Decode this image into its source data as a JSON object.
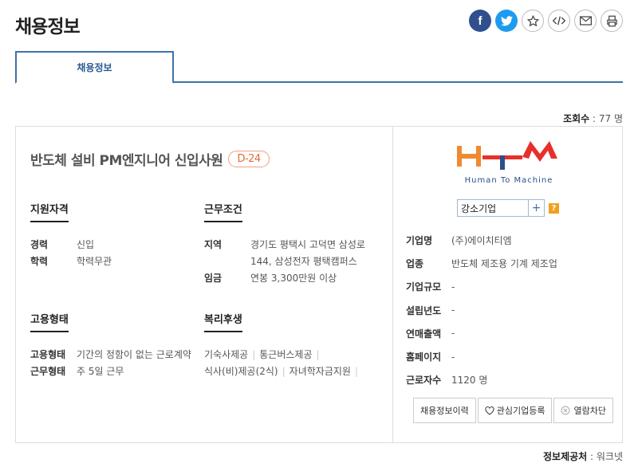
{
  "page_title": "채용정보",
  "share": {
    "facebook": "f"
  },
  "tab": {
    "label": "채용정보"
  },
  "views": {
    "label": "조회수",
    "value": "77 명"
  },
  "job": {
    "title": "반도체 설비 PM엔지니어 신입사원",
    "dday": "D-24"
  },
  "qualification": {
    "heading": "지원자격",
    "rows": [
      {
        "k": "경력",
        "v": "신입"
      },
      {
        "k": "학력",
        "v": "학력무관"
      }
    ]
  },
  "conditions": {
    "heading": "근무조건",
    "rows": [
      {
        "k": "지역",
        "v1": "경기도 평택시 고덕면 삼성로",
        "v2": "144, 삼성전자 평택캠퍼스"
      },
      {
        "k": "임금",
        "v1": "연봉 3,300만원 이상"
      }
    ]
  },
  "employment": {
    "heading": "고용형태",
    "rows": [
      {
        "k": "고용형태",
        "v": "기간의 정함이 없는 근로계약"
      },
      {
        "k": "근무형태",
        "v": "주 5일 근무"
      }
    ]
  },
  "welfare": {
    "heading": "복리후생",
    "items": [
      "기숙사제공",
      "통근버스제공",
      "식사(비)제공(2식)",
      "자녀학자금지원"
    ]
  },
  "company": {
    "logo_text": "Human To Machine",
    "badge": "강소기업",
    "badge_plus": "+",
    "badge_help": "?",
    "info": [
      {
        "k": "기업명",
        "v": "(주)에이치티엠"
      },
      {
        "k": "업종",
        "v": "반도체 제조용 기계 제조업"
      },
      {
        "k": "기업규모",
        "v": "-"
      },
      {
        "k": "설립년도",
        "v": "-"
      },
      {
        "k": "연매출액",
        "v": "-"
      },
      {
        "k": "홈페이지",
        "v": "-"
      },
      {
        "k": "근로자수",
        "v": "1120 명"
      }
    ],
    "buttons": {
      "history": "채용정보이력",
      "interest": "관심기업등록",
      "block": "열람차단"
    }
  },
  "source": {
    "label": "정보제공처",
    "value": "워크넷"
  },
  "colors": {
    "accent": "#3e72a8",
    "dday": "#e26a3d",
    "logo_orange": "#f08a30",
    "logo_red": "#e8302a",
    "logo_blue": "#2a4f8a"
  }
}
